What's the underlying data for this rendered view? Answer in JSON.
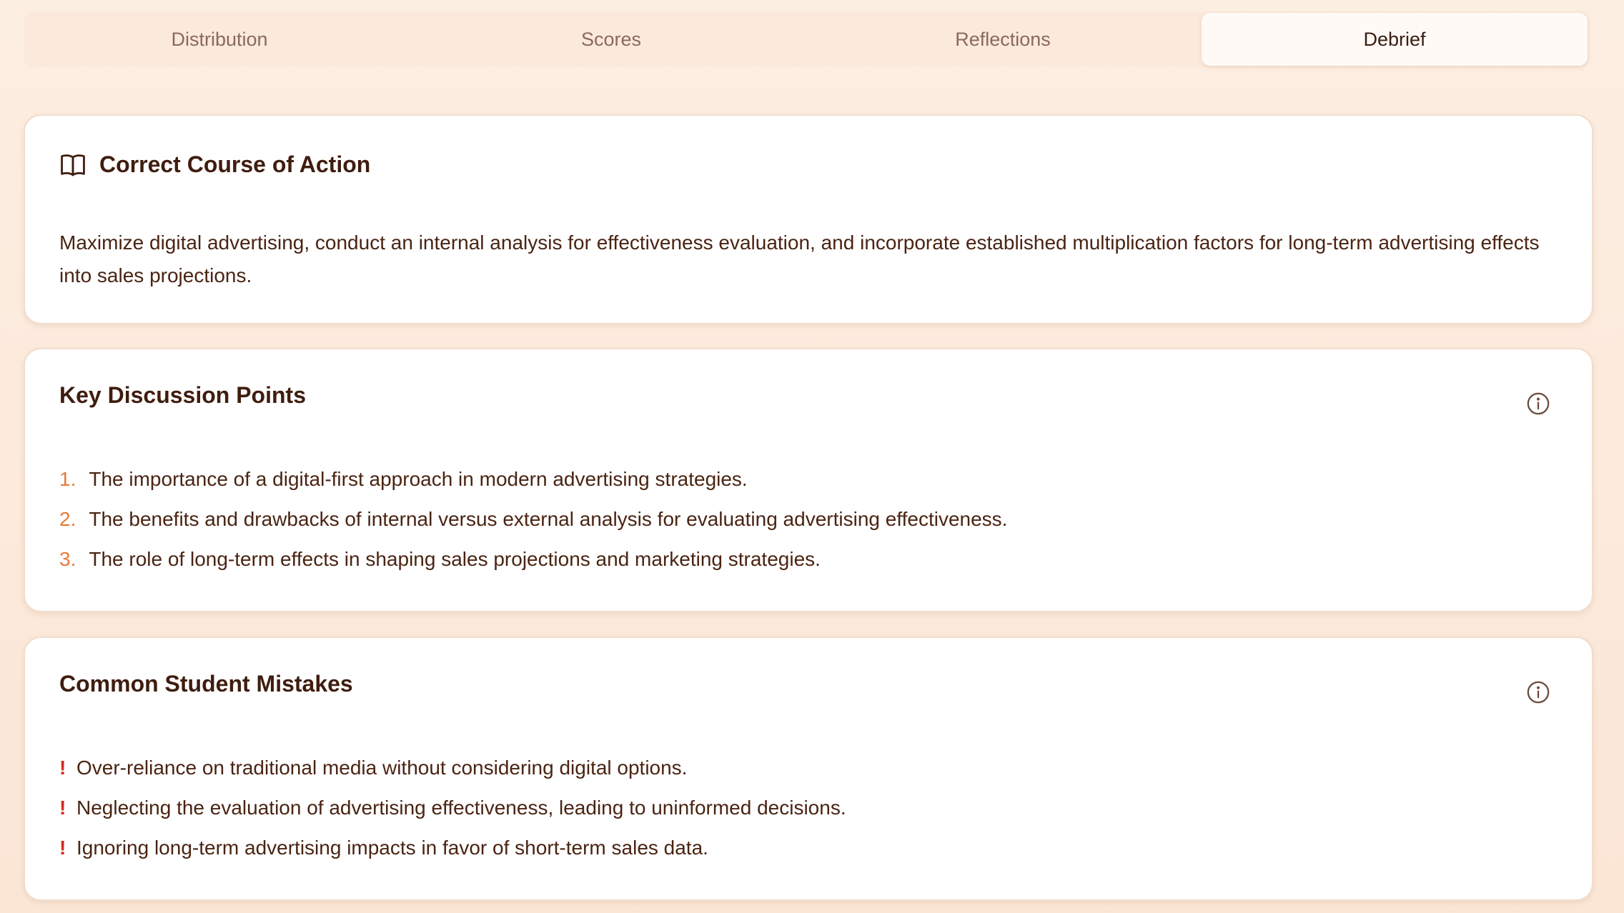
{
  "tabs": [
    {
      "label": "Distribution",
      "active": false
    },
    {
      "label": "Scores",
      "active": false
    },
    {
      "label": "Reflections",
      "active": false
    },
    {
      "label": "Debrief",
      "active": true
    }
  ],
  "correct_course": {
    "icon": "book-open-icon",
    "title": "Correct Course of Action",
    "text": "Maximize digital advertising, conduct an internal analysis for effectiveness evaluation, and incorporate established multiplication factors for long-term advertising effects into sales projections."
  },
  "key_points": {
    "title": "Key Discussion Points",
    "info_icon": "info-icon",
    "items": [
      {
        "num": "1.",
        "text": "The importance of a digital-first approach in modern advertising strategies."
      },
      {
        "num": "2.",
        "text": "The benefits and drawbacks of internal versus external analysis for evaluating advertising effectiveness."
      },
      {
        "num": "3.",
        "text": "The role of long-term effects in shaping sales projections and marketing strategies."
      }
    ]
  },
  "mistakes": {
    "title": "Common Student Mistakes",
    "info_icon": "info-icon",
    "marker": "!",
    "items": [
      {
        "text": "Over-reliance on traditional media without considering digital options."
      },
      {
        "text": "Neglecting the evaluation of advertising effectiveness, leading to uninformed decisions."
      },
      {
        "text": "Ignoring long-term advertising impacts in favor of short-term sales data."
      }
    ]
  },
  "colors": {
    "accent_number": "#e8793a",
    "mistake_marker": "#d9261c",
    "text": "#4a2413"
  }
}
